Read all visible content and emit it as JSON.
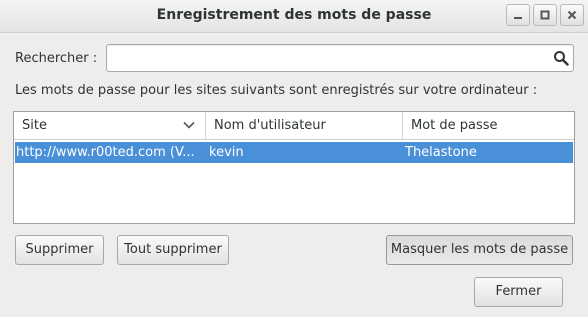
{
  "window": {
    "title": "Enregistrement des mots de passe",
    "controls": [
      "minimize-icon",
      "maximize-icon",
      "close-icon"
    ]
  },
  "search": {
    "label": "Rechercher :",
    "value": "",
    "placeholder": ""
  },
  "description": "Les mots de passe pour les sites suivants sont enregistrés sur votre ordinateur :",
  "table": {
    "columns": [
      "Site",
      "Nom d'utilisateur",
      "Mot de passe"
    ],
    "rows": [
      {
        "site": "http://www.r00ted.com (V...",
        "username": "kevin",
        "password": "Thelastone",
        "selected": true
      }
    ]
  },
  "buttons": {
    "remove": "Supprimer",
    "remove_all": "Tout supprimer",
    "hide_passwords": "Masquer les mots de passe",
    "close": "Fermer"
  },
  "colors": {
    "selection": "#4a90d9",
    "window_bg": "#ededec"
  }
}
